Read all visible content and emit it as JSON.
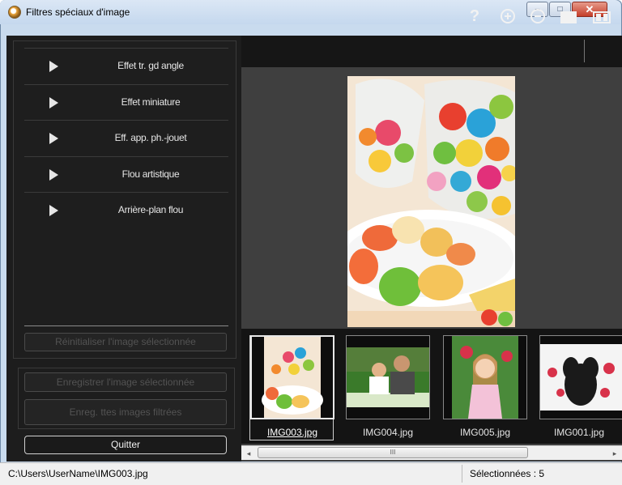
{
  "window": {
    "title": "Filtres spéciaux d'image",
    "minimize_label": "–",
    "maximize_label": "□",
    "close_label": "✕"
  },
  "effects": [
    {
      "label": "Effet tr. gd angle"
    },
    {
      "label": "Effet miniature"
    },
    {
      "label": "Eff. app. ph.-jouet"
    },
    {
      "label": "Flou artistique"
    },
    {
      "label": "Arrière-plan flou"
    }
  ],
  "buttons": {
    "reset": "Réinitialiser l'image sélectionnée",
    "save_selected": "Enregistrer l'image sélectionnée",
    "save_filtered": "Enreg. ttes images filtrées",
    "quit": "Quitter"
  },
  "toolbar": {
    "help": "?",
    "icons": [
      "help-icon",
      "zoom-in-icon",
      "zoom-out-icon",
      "full-screen-icon",
      "compare-view-icon"
    ]
  },
  "thumbnails": [
    {
      "label": "IMG003.jpg",
      "selected": true
    },
    {
      "label": "IMG004.jpg",
      "selected": false
    },
    {
      "label": "IMG005.jpg",
      "selected": false
    },
    {
      "label": "IMG001.jpg",
      "selected": false
    }
  ],
  "scrollbar": {
    "left_arrow": "◂",
    "right_arrow": "▸",
    "grip": "III"
  },
  "status": {
    "path": "C:\\Users\\UserName\\IMG003.jpg",
    "selected_count": "Sélectionnées : 5"
  },
  "colors": {
    "panel_dark": "#1d1d1d",
    "preview_bg": "#3f3f3f",
    "titlebar": "#c5d8ee",
    "close_red": "#c43e2a"
  }
}
